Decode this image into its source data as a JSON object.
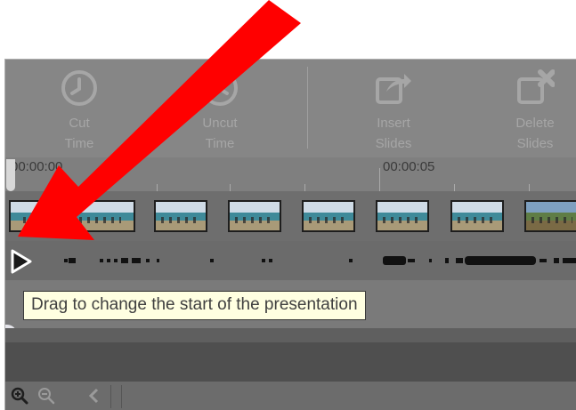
{
  "toolbar": {
    "cut_time": {
      "line1": "Cut",
      "line2": "Time",
      "icon": "clock-icon"
    },
    "uncut_time": {
      "line1": "Uncut",
      "line2": "Time",
      "icon": "clock-undo-icon"
    },
    "insert_slides": {
      "line1": "Insert",
      "line2": "Slides",
      "icon": "insert-slide-icon"
    },
    "delete_slides": {
      "line1": "Delete",
      "line2": "Slides",
      "icon": "delete-slide-icon"
    }
  },
  "ruler": {
    "time_start": "00:00:00",
    "time_mark": "00:00:05"
  },
  "tooltip": {
    "text": "Drag to change the start of the presentation"
  },
  "zoom": {
    "zoom_in_icon": "zoom-in-icon",
    "zoom_out_icon": "zoom-out-icon",
    "back_icon": "chevron-left-icon"
  },
  "colors": {
    "arrow": "#ff0000",
    "tooltip_bg": "#ffffe1",
    "panel": "#8a8a8a"
  }
}
